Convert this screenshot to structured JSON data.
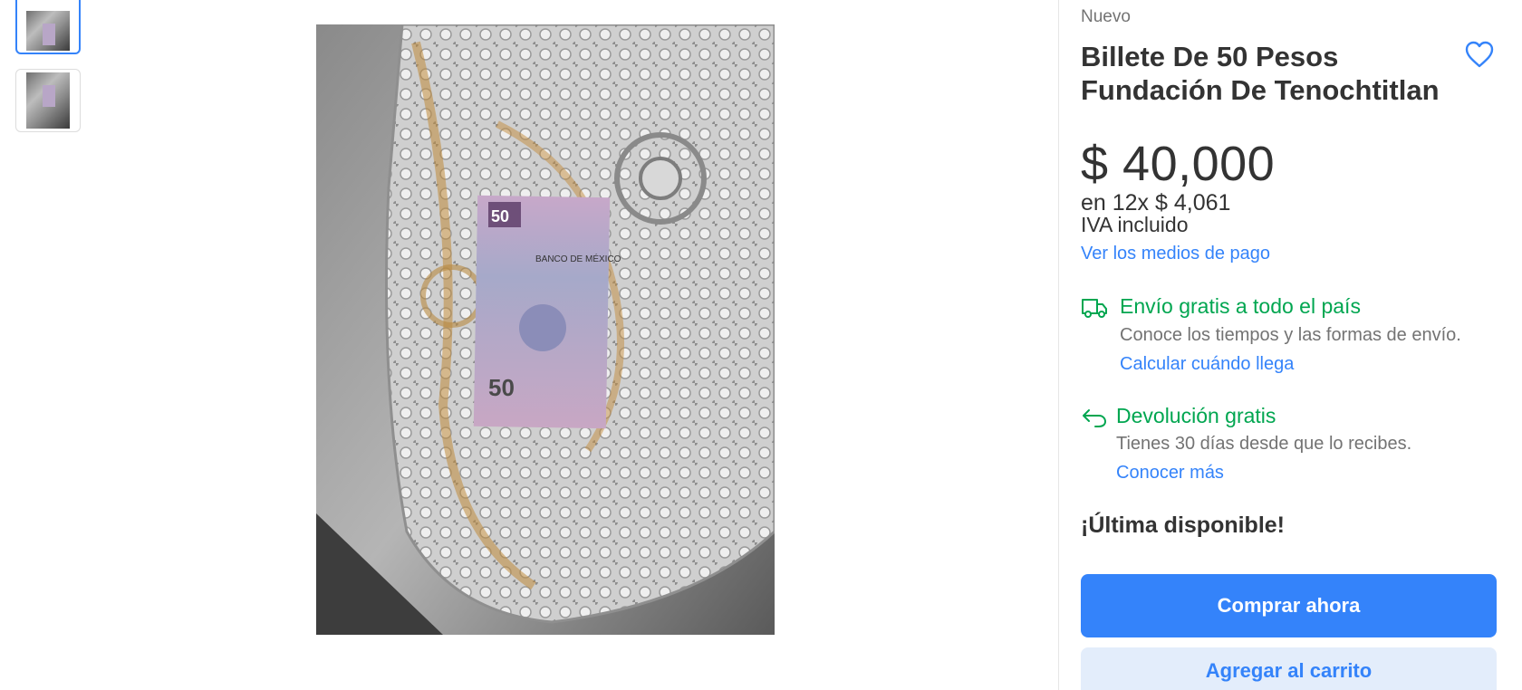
{
  "gallery": {
    "thumbnails": [
      {
        "icon": "product-photo-thumbnail-1",
        "selected": true
      },
      {
        "icon": "product-photo-thumbnail-2",
        "selected": false
      }
    ],
    "main_image": {
      "icon": "banknote-on-lace-tablecloth-photo"
    }
  },
  "product": {
    "condition": "Nuevo",
    "title": "Billete De 50 Pesos Fundación De Tenochtitlan",
    "favorite_icon": "heart-icon",
    "price": "$ 40,000",
    "installments": "en 12x $ 4,061",
    "tax_note": "IVA incluido",
    "payment_link": "Ver los medios de pago"
  },
  "shipping": {
    "icon": "truck-icon",
    "headline": "Envío gratis a todo el país",
    "description": "Conoce los tiempos y las formas de envío.",
    "link": "Calcular cuándo llega"
  },
  "returns": {
    "icon": "return-arrow-icon",
    "headline": "Devolución gratis",
    "description": "Tienes 30 días desde que lo recibes.",
    "link": "Conocer más"
  },
  "stock": {
    "label": "¡Última disponible!"
  },
  "actions": {
    "buy_now": "Comprar ahora",
    "add_to_cart": "Agregar al carrito"
  },
  "colors": {
    "accent": "#3483fa",
    "success": "#00a650",
    "text": "#333333",
    "muted": "#737373",
    "secondary_button_bg": "#e3edfb"
  }
}
